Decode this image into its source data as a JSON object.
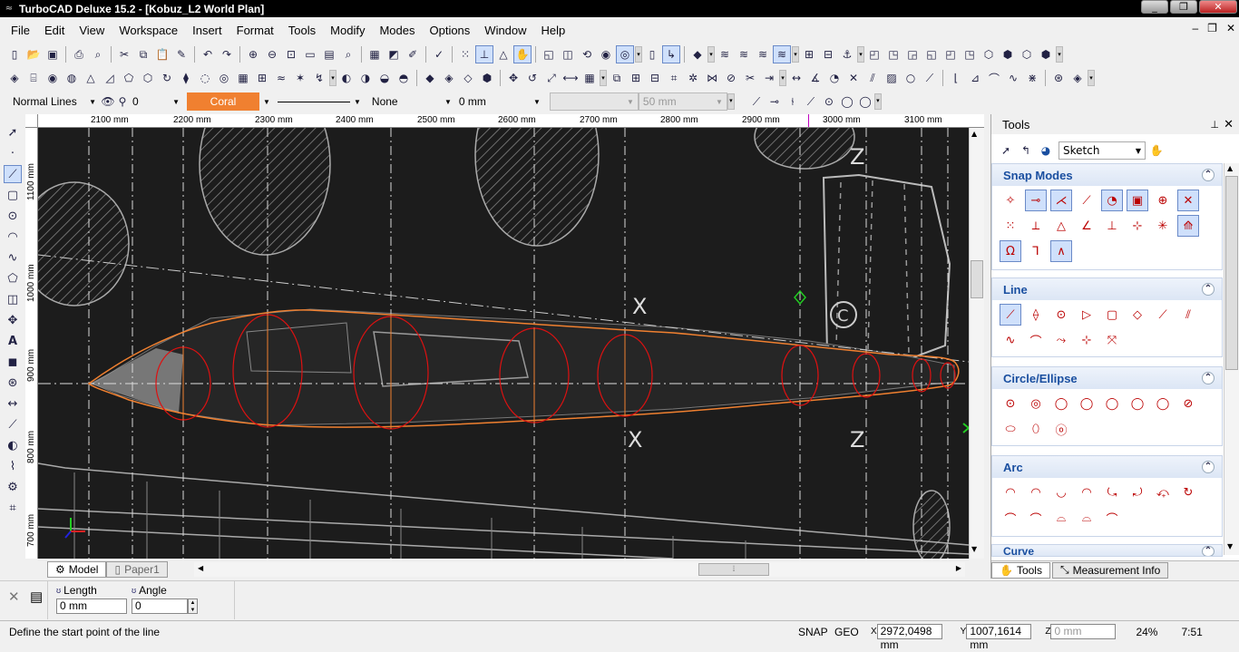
{
  "app": {
    "title": "TurboCAD Deluxe 15.2 - [Kobuz_L2 World Plan]"
  },
  "window_controls": {
    "minimize": "_",
    "restore": "❐",
    "close": "✕"
  },
  "menu": {
    "items": [
      "File",
      "Edit",
      "View",
      "Workspace",
      "Insert",
      "Format",
      "Tools",
      "Modify",
      "Modes",
      "Options",
      "Window",
      "Help"
    ],
    "mdi_controls": [
      "–",
      "❐",
      "✕"
    ]
  },
  "properties": {
    "line_style": "Normal Lines",
    "layer_value": "0",
    "color": "Coral",
    "color_hex": "#f08030",
    "fill": "None",
    "width": "0 mm",
    "height_field": "50 mm"
  },
  "ruler": {
    "top_labels": [
      "2100 mm",
      "2200 mm",
      "2300 mm",
      "2400 mm",
      "2500 mm",
      "2600 mm",
      "2700 mm",
      "2800 mm",
      "2900 mm",
      "3000 mm",
      "3100 mm"
    ],
    "left_labels": [
      "1100 mm",
      "1000 mm",
      "900 mm",
      "800 mm",
      "700 mm"
    ]
  },
  "drawing": {
    "letters": [
      "X",
      "X",
      "Z",
      "Z",
      "C"
    ]
  },
  "tabs": {
    "model": "Model",
    "paper": "Paper1"
  },
  "inspector": {
    "length_label": "Length",
    "length_value": "0 mm",
    "angle_label": "Angle",
    "angle_value": "0"
  },
  "status": {
    "prompt": "Define the start point of the line",
    "snap": "SNAP",
    "geo": "GEO",
    "x": "2972,0498 mm",
    "y": "1007,1614 mm",
    "z": "0 mm",
    "zoom": "24%",
    "time": "7:51"
  },
  "tools_panel": {
    "title": "Tools",
    "mode": "Sketch",
    "sections": {
      "snap": "Snap Modes",
      "line": "Line",
      "circle": "Circle/Ellipse",
      "arc": "Arc",
      "curve": "Curve"
    },
    "bottom_tabs": [
      "Tools",
      "Measurement Info"
    ]
  }
}
